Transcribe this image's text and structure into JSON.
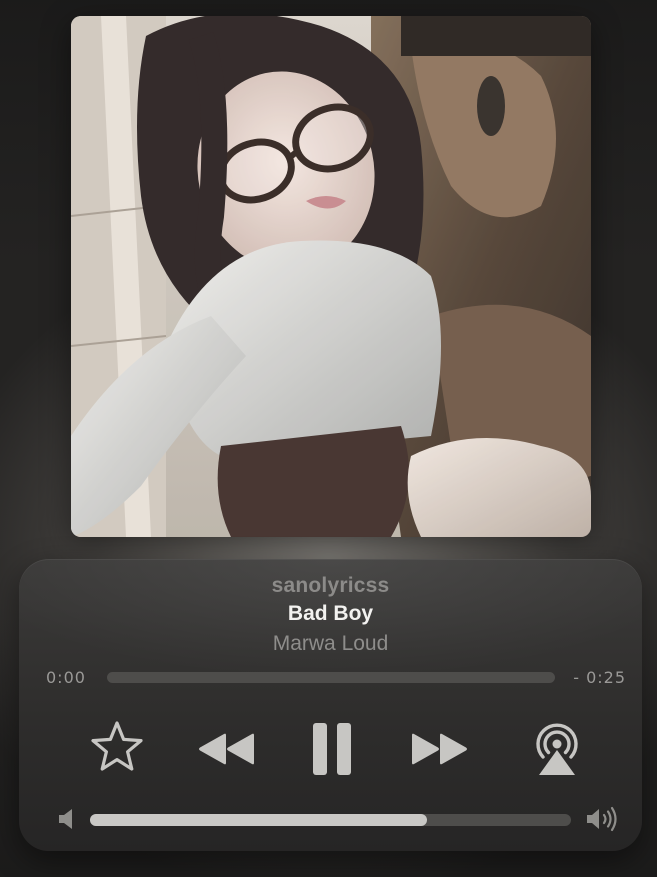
{
  "artwork": {
    "icon": "album-artwork"
  },
  "track": {
    "username": "sanolyricss",
    "title": "Bad Boy",
    "artist": "Marwa Loud"
  },
  "playback": {
    "elapsed": "0:00",
    "remaining": "- 0:25",
    "progress_fraction": 0.0,
    "state": "playing"
  },
  "volume": {
    "level_fraction": 0.7
  },
  "controls": {
    "favorite_icon": "star-icon",
    "rewind_icon": "rewind-icon",
    "pause_icon": "pause-icon",
    "forward_icon": "fast-forward-icon",
    "airplay_icon": "airplay-audio-icon",
    "volume_low_icon": "speaker-low-icon",
    "volume_high_icon": "speaker-high-icon"
  },
  "colors": {
    "control_tint": "#c7c6c3",
    "card_bg": "#302f2e",
    "title_text": "#f3f2f0",
    "secondary_text": "#8e8d8b"
  }
}
